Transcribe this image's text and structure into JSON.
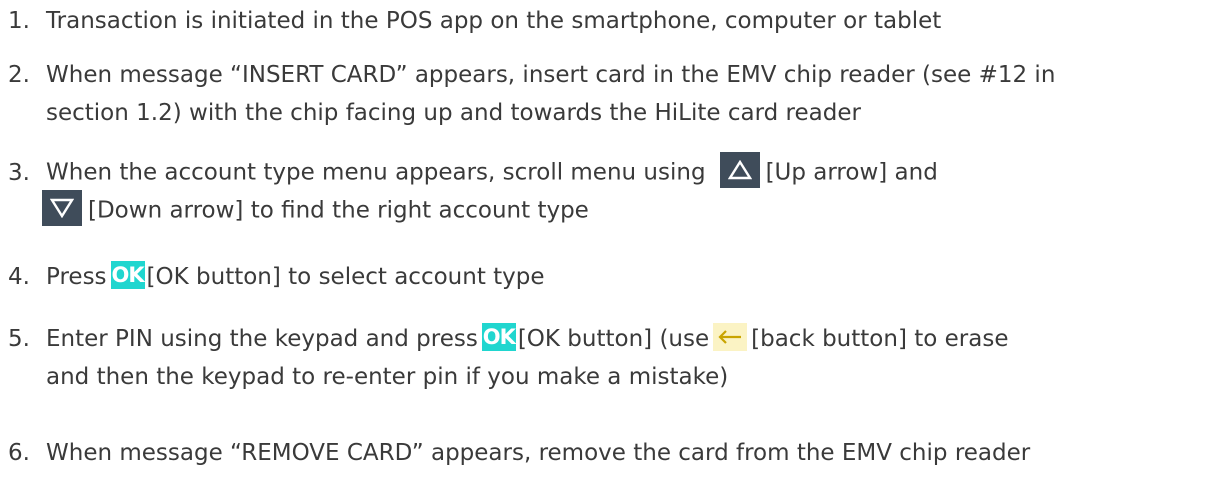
{
  "steps": [
    {
      "number": "1.",
      "text": "Transaction is initiated in the POS app on the smartphone, computer or tablet"
    },
    {
      "number": "2.",
      "line1": "When message “INSERT CARD” appears, insert card in the EMV chip reader (see #12 in",
      "line2": "section 1.2)  with the chip facing up and towards the HiLite card reader"
    },
    {
      "number": "3.",
      "line1_a": "When the account type menu appears, scroll menu using",
      "line1_b": "[Up arrow] and",
      "line2_b": "[Down arrow] to find the right account type"
    },
    {
      "number": "4.",
      "before": "Press",
      "after": "[OK button] to select account type"
    },
    {
      "number": "5.",
      "before": "Enter PIN using the keypad and press",
      "middle": "[OK button] (use",
      "after": "[back button] to erase",
      "line2": "and then the keypad to re-enter pin if you make a mistake)"
    },
    {
      "number": "6.",
      "text": "When message “REMOVE CARD” appears, remove the card from the EMV chip reader"
    }
  ],
  "icons": {
    "up_arrow": "up-arrow-icon",
    "down_arrow": "down-arrow-icon",
    "ok": "OK",
    "back": "back-arrow-icon"
  },
  "colors": {
    "text": "#3a3a3a",
    "arrow_box": "#3f4c5a",
    "ok_button": "#20d6cf",
    "back_button": "#fbf3c4",
    "back_arrow": "#c9a400"
  }
}
